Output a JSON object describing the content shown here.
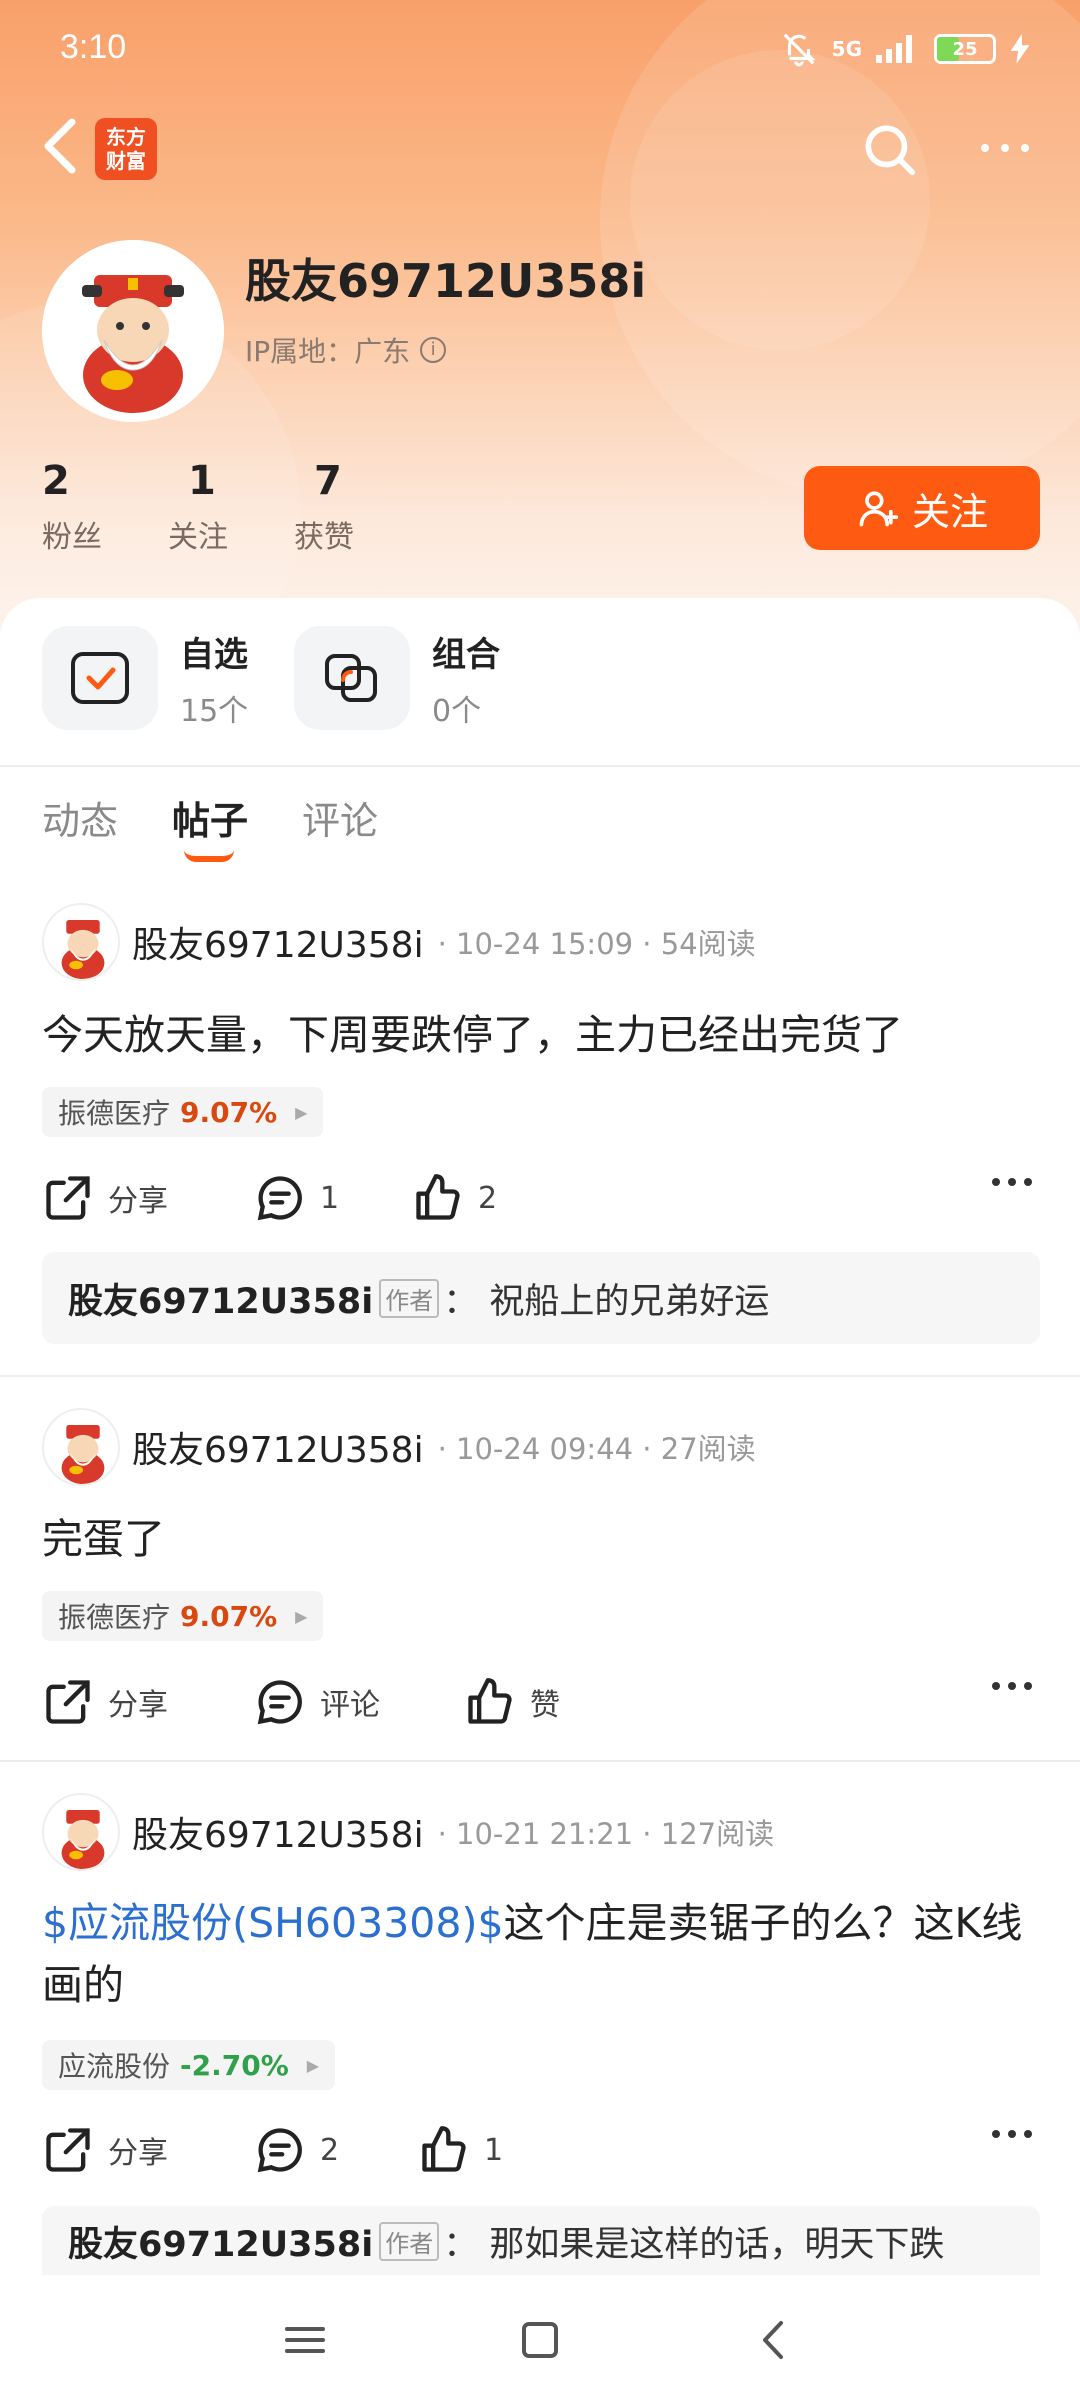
{
  "status_bar": {
    "time": "3:10",
    "network": "5G",
    "battery": "25"
  },
  "header": {
    "app_logo_text": "东方财富",
    "username": "股友69712U358i",
    "ip_label": "IP属地：广东",
    "follow_label": "关注",
    "stats": [
      {
        "num": "2",
        "label": "粉丝"
      },
      {
        "num": "1",
        "label": "关注"
      },
      {
        "num": "7",
        "label": "获赞"
      }
    ]
  },
  "shortcuts": [
    {
      "title": "自选",
      "sub": "15个"
    },
    {
      "title": "组合",
      "sub": "0个"
    }
  ],
  "tabs": [
    "动态",
    "帖子",
    "评论"
  ],
  "active_tab": "帖子",
  "posts": [
    {
      "author": "股友69712U358i",
      "meta": "· 10-24 15:09 · 54阅读",
      "body_text": "今天放天量，下周要跌停了，主力已经出完货了",
      "stock_name": "振德医疗",
      "stock_pct": "9.07%",
      "share_label": "分享",
      "comment_label": "1",
      "like_label": "2",
      "comment": {
        "name": "股友69712U358i",
        "author_tag": "作者",
        "text": "：  祝船上的兄弟好运"
      }
    },
    {
      "author": "股友69712U358i",
      "meta": "· 10-24 09:44 · 27阅读",
      "body_text": "完蛋了",
      "stock_name": "振德医疗",
      "stock_pct": "9.07%",
      "share_label": "分享",
      "comment_label": "评论",
      "like_label": "赞"
    },
    {
      "author": "股友69712U358i",
      "meta": "· 10-21 21:21 · 127阅读",
      "body_link": "$应流股份(SH603308)$",
      "body_text": "这个庄是卖锯子的么？这K线画的",
      "stock_name": "应流股份",
      "stock_pct": "-2.70%",
      "share_label": "分享",
      "comment_label": "2",
      "like_label": "1",
      "comment": {
        "name": "股友69712U358i",
        "author_tag": "作者",
        "text": "：  那如果是这样的话，明天下跌"
      }
    }
  ],
  "colors": {
    "accent": "#ff5a12",
    "up": "#d9480f",
    "down": "#2fa14a",
    "link": "#2b6fd1"
  }
}
